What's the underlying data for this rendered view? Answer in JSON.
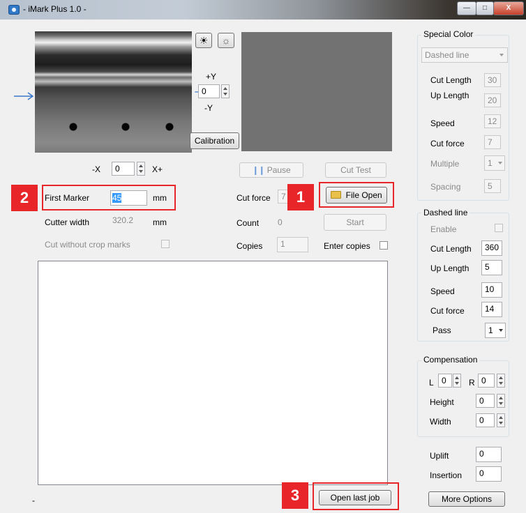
{
  "window": {
    "title": "- iMark Plus 1.0 -",
    "minimize_label": "—",
    "maximize_label": "□",
    "close_label": "X"
  },
  "camera": {
    "plus_y": "+Y",
    "minus_y": "-Y",
    "y_value": "0",
    "calibration_label": "Calibration",
    "minus_x": "-X",
    "plus_x": "X+",
    "x_value": "0"
  },
  "marker": {
    "first_marker_label": "First Marker",
    "first_marker_value": "45",
    "first_marker_unit": "mm",
    "cutter_width_label": "Cutter width",
    "cutter_width_value": "320.2",
    "cutter_width_unit": "mm",
    "cut_without_crop_label": "Cut without crop marks"
  },
  "controls": {
    "pause_label": "Pause",
    "cut_test_label": "Cut Test",
    "cut_force_label": "Cut force",
    "cut_force_value": "7",
    "file_open_label": "File Open",
    "count_label": "Count",
    "count_value": "0",
    "start_label": "Start",
    "copies_label": "Copies",
    "copies_value": "1",
    "enter_copies_label": "Enter copies",
    "open_last_job_label": "Open last job",
    "status_text": "-"
  },
  "special_color": {
    "title": "Special Color",
    "mode_value": "Dashed line",
    "cut_length_label": "Cut Length",
    "cut_length_value": "30",
    "up_length_label": "Up Length",
    "up_length_value": "20",
    "speed_label": "Speed",
    "speed_value": "12",
    "cut_force_label": "Cut force",
    "cut_force_value": "7",
    "multiple_label": "Multiple",
    "multiple_value": "1",
    "spacing_label": "Spacing",
    "spacing_value": "5"
  },
  "dashed_line": {
    "title": "Dashed line",
    "enable_label": "Enable",
    "cut_length_label": "Cut Length",
    "cut_length_value": "360",
    "up_length_label": "Up Length",
    "up_length_value": "5",
    "speed_label": "Speed",
    "speed_value": "10",
    "cut_force_label": "Cut force",
    "cut_force_value": "14",
    "pass_label": "Pass",
    "pass_value": "1"
  },
  "compensation": {
    "title": "Compensation",
    "l_label": "L",
    "l_value": "0",
    "r_label": "R",
    "r_value": "0",
    "height_label": "Height",
    "height_value": "0",
    "width_label": "Width",
    "width_value": "0"
  },
  "bottom_right": {
    "uplift_label": "Uplift",
    "uplift_value": "0",
    "insertion_label": "Insertion",
    "insertion_value": "0",
    "more_options_label": "More Options"
  },
  "annotations": {
    "badge_1": "1",
    "badge_2": "2",
    "badge_3": "3"
  },
  "colors": {
    "annotation_red": "#e8262a",
    "selection_blue": "#3399ff",
    "arrow_blue": "#3b78c8"
  }
}
